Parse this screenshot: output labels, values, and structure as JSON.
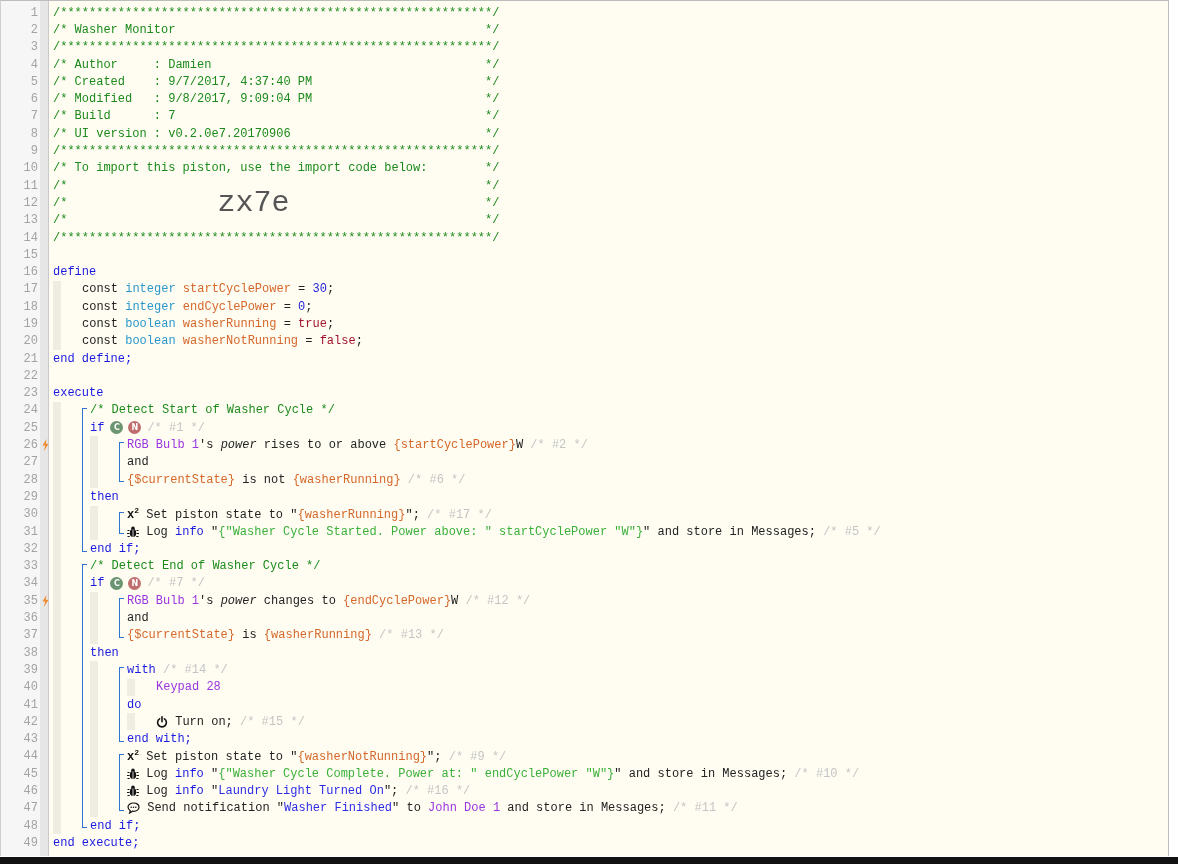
{
  "gutter": [
    {
      "number": "1",
      "trigger": false
    },
    {
      "number": "2",
      "trigger": false
    },
    {
      "number": "3",
      "trigger": false
    },
    {
      "number": "4",
      "trigger": false
    },
    {
      "number": "5",
      "trigger": false
    },
    {
      "number": "6",
      "trigger": false
    },
    {
      "number": "7",
      "trigger": false
    },
    {
      "number": "8",
      "trigger": false
    },
    {
      "number": "9",
      "trigger": false
    },
    {
      "number": "10",
      "trigger": false
    },
    {
      "number": "11",
      "trigger": false
    },
    {
      "number": "12",
      "trigger": false
    },
    {
      "number": "13",
      "trigger": false
    },
    {
      "number": "14",
      "trigger": false
    },
    {
      "number": "15",
      "trigger": false
    },
    {
      "number": "16",
      "trigger": false
    },
    {
      "number": "17",
      "trigger": false
    },
    {
      "number": "18",
      "trigger": false
    },
    {
      "number": "19",
      "trigger": false
    },
    {
      "number": "20",
      "trigger": false
    },
    {
      "number": "21",
      "trigger": false
    },
    {
      "number": "22",
      "trigger": false
    },
    {
      "number": "23",
      "trigger": false
    },
    {
      "number": "24",
      "trigger": false
    },
    {
      "number": "25",
      "trigger": false
    },
    {
      "number": "26",
      "trigger": true
    },
    {
      "number": "27",
      "trigger": false
    },
    {
      "number": "28",
      "trigger": false
    },
    {
      "number": "29",
      "trigger": false
    },
    {
      "number": "30",
      "trigger": false
    },
    {
      "number": "31",
      "trigger": false
    },
    {
      "number": "32",
      "trigger": false
    },
    {
      "number": "33",
      "trigger": false
    },
    {
      "number": "34",
      "trigger": false
    },
    {
      "number": "35",
      "trigger": true
    },
    {
      "number": "36",
      "trigger": false
    },
    {
      "number": "37",
      "trigger": false
    },
    {
      "number": "38",
      "trigger": false
    },
    {
      "number": "39",
      "trigger": false
    },
    {
      "number": "40",
      "trigger": false
    },
    {
      "number": "41",
      "trigger": false
    },
    {
      "number": "42",
      "trigger": false
    },
    {
      "number": "43",
      "trigger": false
    },
    {
      "number": "44",
      "trigger": false
    },
    {
      "number": "45",
      "trigger": false
    },
    {
      "number": "46",
      "trigger": false
    },
    {
      "number": "47",
      "trigger": false
    },
    {
      "number": "48",
      "trigger": false
    },
    {
      "number": "49",
      "trigger": false
    }
  ],
  "code": [
    {
      "kind": "line",
      "tokens": [
        {
          "kind": "comment",
          "text": "/************************************************************/"
        }
      ]
    },
    {
      "kind": "line",
      "tokens": [
        {
          "kind": "comment",
          "text": "/* Washer Monitor"
        },
        {
          "kind": "comment_end",
          "text": "*/"
        }
      ]
    },
    {
      "kind": "line",
      "tokens": [
        {
          "kind": "comment",
          "text": "/************************************************************/"
        }
      ]
    },
    {
      "kind": "line",
      "tokens": [
        {
          "kind": "comment",
          "text": "/* Author     : Damien"
        },
        {
          "kind": "comment_end",
          "text": "*/"
        }
      ]
    },
    {
      "kind": "line",
      "tokens": [
        {
          "kind": "comment",
          "text": "/* Created    : 9/7/2017, 4:37:40 PM"
        },
        {
          "kind": "comment_end",
          "text": "*/"
        }
      ]
    },
    {
      "kind": "line",
      "tokens": [
        {
          "kind": "comment",
          "text": "/* Modified   : 9/8/2017, 9:09:04 PM"
        },
        {
          "kind": "comment_end",
          "text": "*/"
        }
      ]
    },
    {
      "kind": "line",
      "tokens": [
        {
          "kind": "comment",
          "text": "/* Build      : 7"
        },
        {
          "kind": "comment_end",
          "text": "*/"
        }
      ]
    },
    {
      "kind": "line",
      "tokens": [
        {
          "kind": "comment",
          "text": "/* UI version : v0.2.0e7.20170906"
        },
        {
          "kind": "comment_end",
          "text": "*/"
        }
      ]
    },
    {
      "kind": "line",
      "tokens": [
        {
          "kind": "comment",
          "text": "/************************************************************/"
        }
      ]
    },
    {
      "kind": "line",
      "tokens": [
        {
          "kind": "comment",
          "text": "/* To import this piston, use the import code below:"
        },
        {
          "kind": "comment_end",
          "text": "*/"
        }
      ]
    },
    {
      "kind": "line",
      "tokens": [
        {
          "kind": "comment",
          "text": "/*"
        },
        {
          "kind": "comment_end",
          "text": "*/"
        }
      ]
    },
    {
      "kind": "line",
      "tokens": [
        {
          "kind": "comment",
          "text": "/*"
        },
        {
          "kind": "import_code",
          "text": "zx7e"
        },
        {
          "kind": "comment_end",
          "text": "*/"
        }
      ]
    },
    {
      "kind": "line",
      "tokens": [
        {
          "kind": "comment",
          "text": "/*"
        },
        {
          "kind": "comment_end",
          "text": "*/"
        }
      ]
    },
    {
      "kind": "line",
      "tokens": [
        {
          "kind": "comment",
          "text": "/************************************************************/"
        }
      ]
    },
    {
      "kind": "line"
    },
    {
      "kind": "line",
      "tokens": [
        {
          "kind": "keyword",
          "text": "define"
        }
      ]
    },
    {
      "kind": "block",
      "children": [
        {
          "kind": "line",
          "tokens": [
            {
              "kind": "plain",
              "text": "const "
            },
            {
              "kind": "type",
              "text": "integer"
            },
            {
              "kind": "variable",
              "text": " startCyclePower"
            },
            {
              "kind": "plain",
              "text": " = "
            },
            {
              "kind": "number",
              "text": "30"
            },
            {
              "kind": "plain",
              "text": ";"
            }
          ]
        },
        {
          "kind": "line",
          "tokens": [
            {
              "kind": "plain",
              "text": "const "
            },
            {
              "kind": "type",
              "text": "integer"
            },
            {
              "kind": "variable",
              "text": " endCyclePower"
            },
            {
              "kind": "plain",
              "text": " = "
            },
            {
              "kind": "number",
              "text": "0"
            },
            {
              "kind": "plain",
              "text": ";"
            }
          ]
        },
        {
          "kind": "line",
          "tokens": [
            {
              "kind": "plain",
              "text": "const "
            },
            {
              "kind": "type",
              "text": "boolean"
            },
            {
              "kind": "variable",
              "text": " washerRunning"
            },
            {
              "kind": "plain",
              "text": " = "
            },
            {
              "kind": "literal",
              "text": "true"
            },
            {
              "kind": "plain",
              "text": ";"
            }
          ]
        },
        {
          "kind": "line",
          "tokens": [
            {
              "kind": "plain",
              "text": "const "
            },
            {
              "kind": "type",
              "text": "boolean"
            },
            {
              "kind": "variable",
              "text": " washerNotRunning"
            },
            {
              "kind": "plain",
              "text": " = "
            },
            {
              "kind": "literal",
              "text": "false"
            },
            {
              "kind": "plain",
              "text": ";"
            }
          ]
        }
      ]
    },
    {
      "kind": "line",
      "tokens": [
        {
          "kind": "keyword",
          "text": "end define;"
        }
      ]
    },
    {
      "kind": "line"
    },
    {
      "kind": "line",
      "tokens": [
        {
          "kind": "keyword",
          "text": "execute"
        }
      ]
    },
    {
      "kind": "block",
      "children": [
        {
          "kind": "group",
          "children": [
            {
              "kind": "line",
              "tokens": [
                {
                  "kind": "comment",
                  "text": "/* Detect Start of Washer Cycle */"
                }
              ]
            },
            {
              "kind": "line",
              "tokens": [
                {
                  "kind": "keyword",
                  "text": "if"
                },
                {
                  "kind": "badge",
                  "text": "C",
                  "color": "#6b9470"
                },
                {
                  "kind": "badge",
                  "text": "N",
                  "color": "#bf6d6d"
                },
                {
                  "kind": "hint",
                  "text": "/* #1 */"
                }
              ]
            },
            {
              "kind": "block",
              "children": [
                {
                  "kind": "group",
                  "children": [
                    {
                      "kind": "line",
                      "tokens": [
                        {
                          "kind": "device",
                          "text": "RGB Bulb 1"
                        },
                        {
                          "kind": "plain",
                          "text": "'s "
                        },
                        {
                          "kind": "attribute",
                          "text": "power"
                        },
                        {
                          "kind": "plain",
                          "text": " rises to or above "
                        },
                        {
                          "kind": "variable",
                          "text": "{startCyclePower}"
                        },
                        {
                          "kind": "plain",
                          "text": "W "
                        },
                        {
                          "kind": "hint",
                          "text": "/* #2 */"
                        }
                      ]
                    },
                    {
                      "kind": "line",
                      "tokens": [
                        {
                          "kind": "plain",
                          "text": "and"
                        }
                      ]
                    },
                    {
                      "kind": "line",
                      "tokens": [
                        {
                          "kind": "variable",
                          "text": "{$currentState}"
                        },
                        {
                          "kind": "plain",
                          "text": " is not "
                        },
                        {
                          "kind": "variable",
                          "text": "{washerRunning}"
                        },
                        {
                          "kind": "hint",
                          "text": " /* #6 */"
                        }
                      ]
                    }
                  ]
                }
              ]
            },
            {
              "kind": "line",
              "tokens": [
                {
                  "kind": "keyword",
                  "text": "then"
                }
              ]
            },
            {
              "kind": "block",
              "children": [
                {
                  "kind": "group",
                  "children": [
                    {
                      "kind": "line",
                      "tokens": [
                        {
                          "kind": "sup",
                          "text": "x$^{2}$"
                        },
                        {
                          "kind": "plain",
                          "text": " Set piston state to \""
                        },
                        {
                          "kind": "variable",
                          "text": "{washerRunning}"
                        },
                        {
                          "kind": "plain",
                          "text": "\"; "
                        },
                        {
                          "kind": "hint",
                          "text": "/* #17 */"
                        }
                      ]
                    },
                    {
                      "kind": "line",
                      "tokens": [
                        {
                          "kind": "bug"
                        },
                        {
                          "kind": "plain",
                          "text": " Log "
                        },
                        {
                          "kind": "keyword",
                          "text": "info"
                        },
                        {
                          "kind": "plain",
                          "text": " \""
                        },
                        {
                          "kind": "message",
                          "text": "{\"Washer Cycle Started. Power above: \" startCyclePower \"W\"}"
                        },
                        {
                          "kind": "plain",
                          "text": "\" and store in Messages; "
                        },
                        {
                          "kind": "hint",
                          "text": "/* #5 */"
                        }
                      ]
                    }
                  ]
                }
              ]
            },
            {
              "kind": "line",
              "tokens": [
                {
                  "kind": "keyword",
                  "text": "end if;"
                }
              ]
            }
          ]
        },
        {
          "kind": "group",
          "children": [
            {
              "kind": "line",
              "tokens": [
                {
                  "kind": "comment",
                  "text": "/* Detect End of Washer Cycle */"
                }
              ]
            },
            {
              "kind": "line",
              "tokens": [
                {
                  "kind": "keyword",
                  "text": "if"
                },
                {
                  "kind": "badge",
                  "text": "C",
                  "color": "#6b9470"
                },
                {
                  "kind": "badge",
                  "text": "N",
                  "color": "#bf6d6d"
                },
                {
                  "kind": "hint",
                  "text": "/* #7 */"
                }
              ]
            },
            {
              "kind": "block",
              "children": [
                {
                  "kind": "group",
                  "children": [
                    {
                      "kind": "line",
                      "tokens": [
                        {
                          "kind": "device",
                          "text": "RGB Bulb 1"
                        },
                        {
                          "kind": "plain",
                          "text": "'s "
                        },
                        {
                          "kind": "attribute",
                          "text": "power"
                        },
                        {
                          "kind": "plain",
                          "text": " changes to "
                        },
                        {
                          "kind": "variable",
                          "text": "{endCyclePower}"
                        },
                        {
                          "kind": "plain",
                          "text": "W "
                        },
                        {
                          "kind": "hint",
                          "text": "/* #12 */"
                        }
                      ]
                    },
                    {
                      "kind": "line",
                      "tokens": [
                        {
                          "kind": "plain",
                          "text": "and"
                        }
                      ]
                    },
                    {
                      "kind": "line",
                      "tokens": [
                        {
                          "kind": "variable",
                          "text": "{$currentState}"
                        },
                        {
                          "kind": "plain",
                          "text": " is "
                        },
                        {
                          "kind": "variable",
                          "text": "{washerRunning}"
                        },
                        {
                          "kind": "hint",
                          "text": " /* #13 */"
                        }
                      ]
                    }
                  ]
                }
              ]
            },
            {
              "kind": "line",
              "tokens": [
                {
                  "kind": "keyword",
                  "text": "then"
                }
              ]
            },
            {
              "kind": "block",
              "children": [
                {
                  "kind": "group",
                  "children": [
                    {
                      "kind": "line",
                      "tokens": [
                        {
                          "kind": "keyword",
                          "text": "with"
                        },
                        {
                          "kind": "hint",
                          "text": " /* #14 */"
                        }
                      ]
                    },
                    {
                      "kind": "block",
                      "children": [
                        {
                          "kind": "line",
                          "tokens": [
                            {
                              "kind": "device",
                              "text": "Keypad 28"
                            }
                          ]
                        }
                      ]
                    },
                    {
                      "kind": "line",
                      "tokens": [
                        {
                          "kind": "keyword",
                          "text": "do"
                        }
                      ]
                    },
                    {
                      "kind": "block",
                      "children": [
                        {
                          "kind": "line",
                          "tokens": [
                            {
                              "kind": "power"
                            },
                            {
                              "kind": "plain",
                              "text": " Turn on; "
                            },
                            {
                              "kind": "hint",
                              "text": "/* #15 */"
                            }
                          ]
                        }
                      ]
                    },
                    {
                      "kind": "line",
                      "tokens": [
                        {
                          "kind": "keyword",
                          "text": "end with;"
                        }
                      ]
                    }
                  ]
                },
                {
                  "kind": "group",
                  "children": [
                    {
                      "kind": "line",
                      "tokens": [
                        {
                          "kind": "sup",
                          "text": "x$^{2}$"
                        },
                        {
                          "kind": "plain",
                          "text": " Set piston state to \""
                        },
                        {
                          "kind": "variable",
                          "text": "{washerNotRunning}"
                        },
                        {
                          "kind": "plain",
                          "text": "\"; "
                        },
                        {
                          "kind": "hint",
                          "text": "/* #9 */"
                        }
                      ]
                    },
                    {
                      "kind": "line",
                      "tokens": [
                        {
                          "kind": "bug"
                        },
                        {
                          "kind": "plain",
                          "text": " Log "
                        },
                        {
                          "kind": "keyword",
                          "text": "info"
                        },
                        {
                          "kind": "plain",
                          "text": " \""
                        },
                        {
                          "kind": "message",
                          "text": "{\"Washer Cycle Complete. Power at: \" endCyclePower \"W\"}"
                        },
                        {
                          "kind": "plain",
                          "text": "\" and store in Messages; "
                        },
                        {
                          "kind": "hint",
                          "text": "/* #10 */"
                        }
                      ]
                    },
                    {
                      "kind": "line",
                      "tokens": [
                        {
                          "kind": "bug"
                        },
                        {
                          "kind": "plain",
                          "text": " Log "
                        },
                        {
                          "kind": "keyword",
                          "text": "info"
                        },
                        {
                          "kind": "plain",
                          "text": " \""
                        },
                        {
                          "kind": "string",
                          "text": "Laundry Light Turned On"
                        },
                        {
                          "kind": "plain",
                          "text": "\"; "
                        },
                        {
                          "kind": "hint",
                          "text": "/* #16 */"
                        }
                      ]
                    },
                    {
                      "kind": "line",
                      "tokens": [
                        {
                          "kind": "chat"
                        },
                        {
                          "kind": "plain",
                          "text": " Send notification \""
                        },
                        {
                          "kind": "string",
                          "text": "Washer Finished"
                        },
                        {
                          "kind": "plain",
                          "text": "\" to "
                        },
                        {
                          "kind": "device",
                          "text": "John Doe 1"
                        },
                        {
                          "kind": "plain",
                          "text": " and store in Messages; "
                        },
                        {
                          "kind": "hint",
                          "text": "/* #11 */"
                        }
                      ]
                    }
                  ]
                }
              ]
            },
            {
              "kind": "line",
              "tokens": [
                {
                  "kind": "keyword",
                  "text": "end if;"
                }
              ]
            }
          ]
        }
      ]
    },
    {
      "kind": "line",
      "tokens": [
        {
          "kind": "keyword",
          "text": "end execute;"
        }
      ]
    }
  ]
}
